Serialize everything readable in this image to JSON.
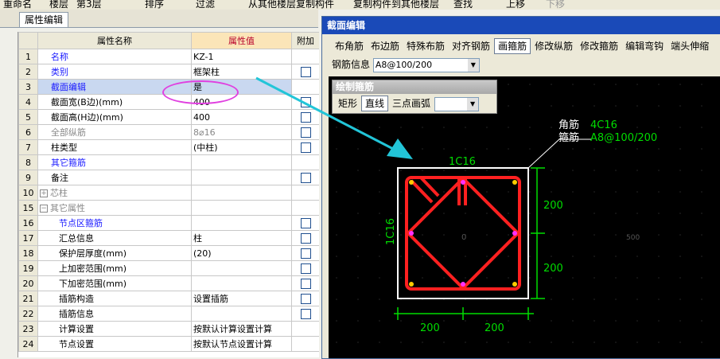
{
  "toolbar": {
    "items": [
      "重命名",
      "楼层",
      "第3层",
      "排序",
      "过滤",
      "从其他楼层复制构件",
      "复制构件到其他楼层",
      "查找",
      "上移",
      "下移"
    ]
  },
  "property_panel": {
    "tab_label": "属性编辑",
    "headers": {
      "name": "属性名称",
      "value": "属性值",
      "extra": "附加"
    },
    "rows": [
      {
        "num": "1",
        "name": "名称",
        "value": "KZ-1",
        "check": false,
        "style": "blue"
      },
      {
        "num": "2",
        "name": "类别",
        "value": "框架柱",
        "check": true,
        "style": "blue"
      },
      {
        "num": "3",
        "name": "截面编辑",
        "value": "是",
        "check": false,
        "style": "sel"
      },
      {
        "num": "4",
        "name": "截面宽(B边)(mm)",
        "value": "400",
        "check": true,
        "style": ""
      },
      {
        "num": "5",
        "name": "截面高(H边)(mm)",
        "value": "400",
        "check": true,
        "style": ""
      },
      {
        "num": "6",
        "name": "全部纵筋",
        "value": "8⌀16",
        "check": true,
        "style": "gray"
      },
      {
        "num": "7",
        "name": "柱类型",
        "value": "(中柱)",
        "check": true,
        "style": ""
      },
      {
        "num": "8",
        "name": "其它箍筋",
        "value": "",
        "check": false,
        "style": "blue"
      },
      {
        "num": "9",
        "name": "备注",
        "value": "",
        "check": true,
        "style": ""
      },
      {
        "num": "10",
        "name": "芯柱",
        "value": "",
        "check": false,
        "style": "gray",
        "expand": "+"
      },
      {
        "num": "15",
        "name": "其它属性",
        "value": "",
        "check": false,
        "style": "gray",
        "expand": "−"
      },
      {
        "num": "16",
        "name": "节点区箍筋",
        "value": "",
        "check": true,
        "style": "blue",
        "indent": true
      },
      {
        "num": "17",
        "name": "汇总信息",
        "value": "柱",
        "check": true,
        "style": "",
        "indent": true
      },
      {
        "num": "18",
        "name": "保护层厚度(mm)",
        "value": "(20)",
        "check": true,
        "style": "",
        "indent": true
      },
      {
        "num": "19",
        "name": "上加密范围(mm)",
        "value": "",
        "check": true,
        "style": "",
        "indent": true
      },
      {
        "num": "20",
        "name": "下加密范围(mm)",
        "value": "",
        "check": true,
        "style": "",
        "indent": true
      },
      {
        "num": "21",
        "name": "插筋构造",
        "value": "设置插筋",
        "check": true,
        "style": "",
        "indent": true
      },
      {
        "num": "22",
        "name": "插筋信息",
        "value": "",
        "check": true,
        "style": "",
        "indent": true
      },
      {
        "num": "23",
        "name": "计算设置",
        "value": "按默认计算设置计算",
        "check": false,
        "style": "",
        "indent": true
      },
      {
        "num": "24",
        "name": "节点设置",
        "value": "按默认节点设置计算",
        "check": false,
        "style": "",
        "indent": true
      }
    ]
  },
  "section_editor": {
    "title": "截面编辑",
    "buttons": [
      "布角筋",
      "布边筋",
      "特殊布筋",
      "对齐钢筋",
      "画箍筋",
      "修改纵筋",
      "修改箍筋",
      "编辑弯钩",
      "端头伸缩"
    ],
    "pressed_button": "画箍筋",
    "rebar_info_label": "钢筋信息",
    "rebar_info_value": "A8@100/200",
    "draw_panel": {
      "title": "绘制箍筋",
      "buttons": [
        "矩形",
        "直线",
        "三点画弧"
      ],
      "pressed": "直线"
    },
    "drawing": {
      "corner_bar_label": "角筋",
      "corner_bar_value": "4C16",
      "stirrup_label": "箍筋",
      "stirrup_value": "A8@100/200",
      "top_bar": "1C16",
      "side_bar": "1C16",
      "dim_right_top": "200",
      "dim_right_bottom": "200",
      "dim_bottom_left": "200",
      "dim_bottom_right": "200",
      "center_label": "0",
      "axis_label": "500"
    }
  },
  "colors": {
    "title_bar": "#1a4ab8",
    "rebar": "#ff2020",
    "dimension": "#00dd00",
    "annotation_arrow": "#22c5d8",
    "highlight_ellipse": "#e040e0"
  }
}
